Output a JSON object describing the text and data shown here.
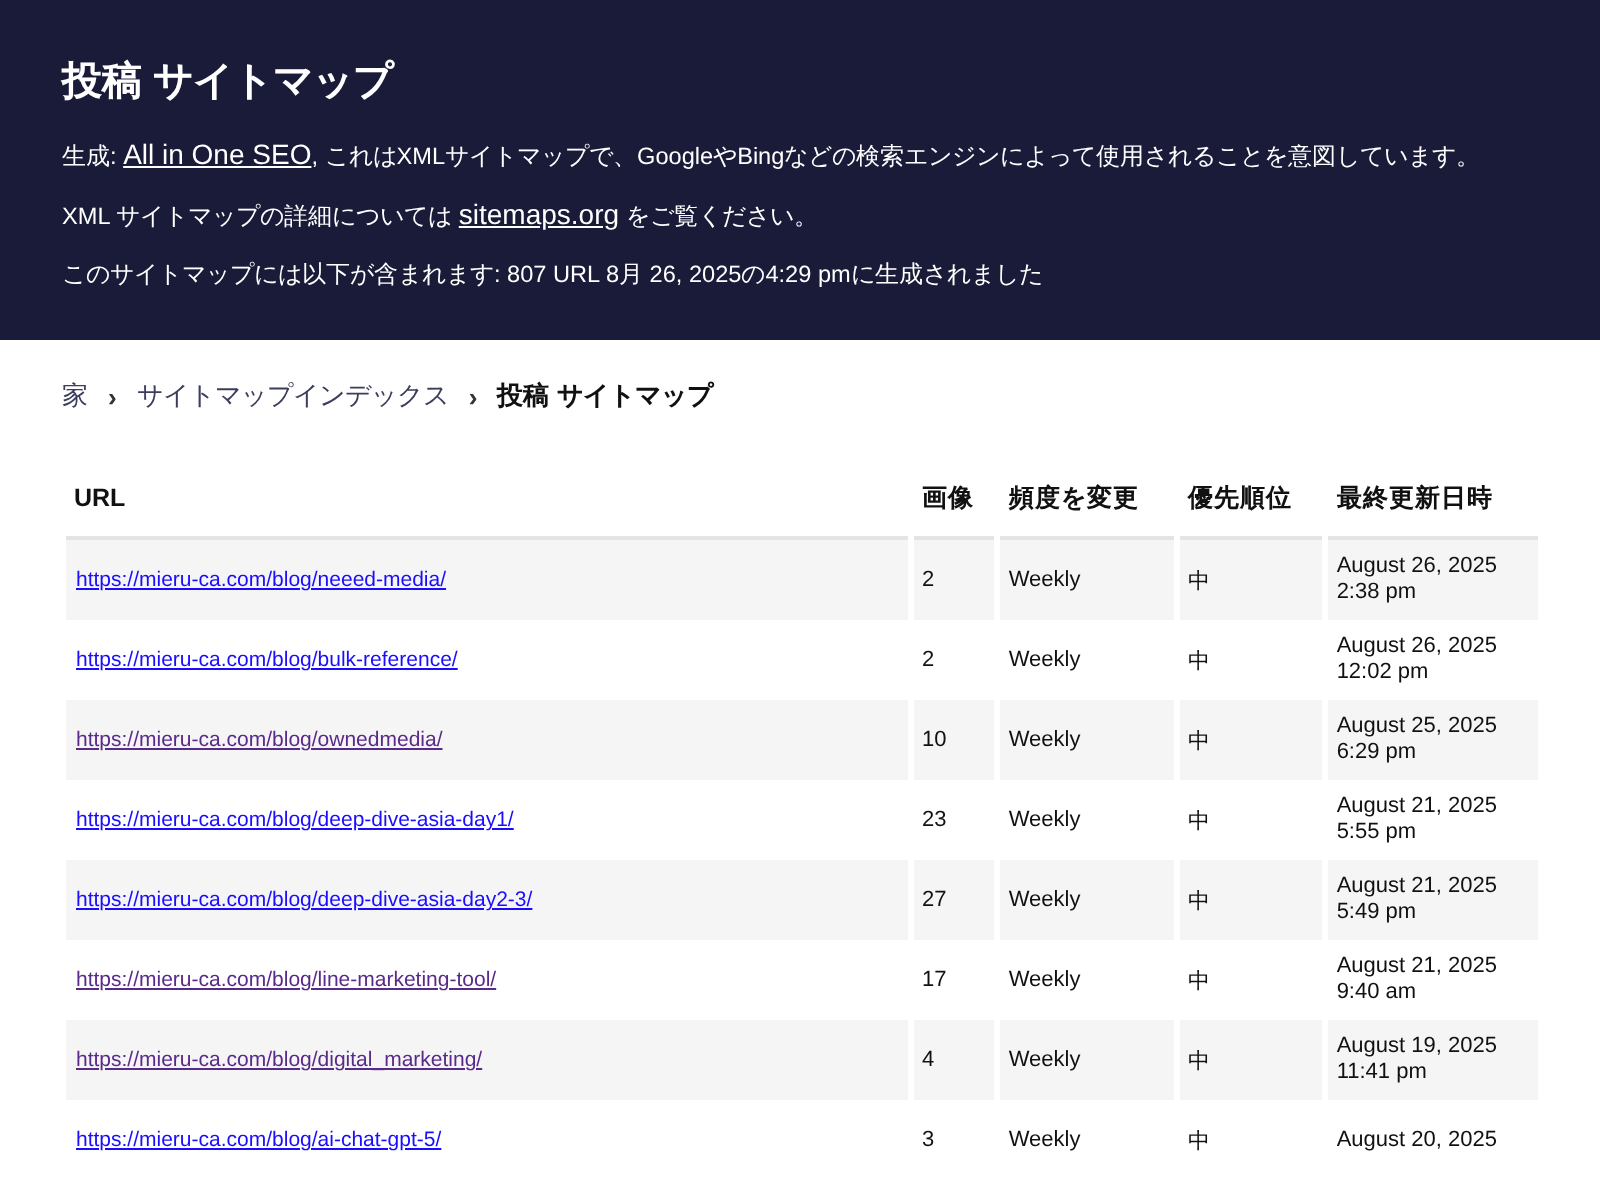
{
  "header": {
    "title": "投稿 サイトマップ",
    "generator_line": {
      "prefix": "生成: ",
      "link": "All in One SEO",
      "suffix": ", これはXMLサイトマップで、GoogleやBingなどの検索エンジンによって使用されることを意図しています。"
    },
    "info_line": {
      "prefix": "XML サイトマップの詳細については ",
      "link": "sitemaps.org",
      "suffix": " をご覧ください。"
    },
    "count_line": "このサイトマップには以下が含まれます: 807 URL 8月 26, 2025の4:29 pmに生成されました"
  },
  "breadcrumb": [
    {
      "label": "家",
      "current": false
    },
    {
      "label": "サイトマップインデックス",
      "current": false
    },
    {
      "label": "投稿 サイトマップ",
      "current": true
    }
  ],
  "breadcrumb_separator": "›",
  "table": {
    "columns": [
      "URL",
      "画像",
      "頻度を変更",
      "優先順位",
      "最終更新日時"
    ],
    "rows": [
      {
        "url": "https://mieru-ca.com/blog/neeed-media/",
        "visited": false,
        "images": "2",
        "frequency": "Weekly",
        "priority": "中",
        "date": "August 26, 2025",
        "time": "2:38 pm"
      },
      {
        "url": "https://mieru-ca.com/blog/bulk-reference/",
        "visited": false,
        "images": "2",
        "frequency": "Weekly",
        "priority": "中",
        "date": "August 26, 2025",
        "time": "12:02 pm"
      },
      {
        "url": "https://mieru-ca.com/blog/ownedmedia/",
        "visited": true,
        "images": "10",
        "frequency": "Weekly",
        "priority": "中",
        "date": "August 25, 2025",
        "time": "6:29 pm"
      },
      {
        "url": "https://mieru-ca.com/blog/deep-dive-asia-day1/",
        "visited": false,
        "images": "23",
        "frequency": "Weekly",
        "priority": "中",
        "date": "August 21, 2025",
        "time": "5:55 pm"
      },
      {
        "url": "https://mieru-ca.com/blog/deep-dive-asia-day2-3/",
        "visited": false,
        "images": "27",
        "frequency": "Weekly",
        "priority": "中",
        "date": "August 21, 2025",
        "time": "5:49 pm"
      },
      {
        "url": "https://mieru-ca.com/blog/line-marketing-tool/",
        "visited": true,
        "images": "17",
        "frequency": "Weekly",
        "priority": "中",
        "date": "August 21, 2025",
        "time": "9:40 am"
      },
      {
        "url": "https://mieru-ca.com/blog/digital_marketing/",
        "visited": true,
        "images": "4",
        "frequency": "Weekly",
        "priority": "中",
        "date": "August 19, 2025",
        "time": "11:41 pm"
      },
      {
        "url": "https://mieru-ca.com/blog/ai-chat-gpt-5/",
        "visited": false,
        "images": "3",
        "frequency": "Weekly",
        "priority": "中",
        "date": "August 20, 2025",
        "time": ""
      }
    ]
  }
}
